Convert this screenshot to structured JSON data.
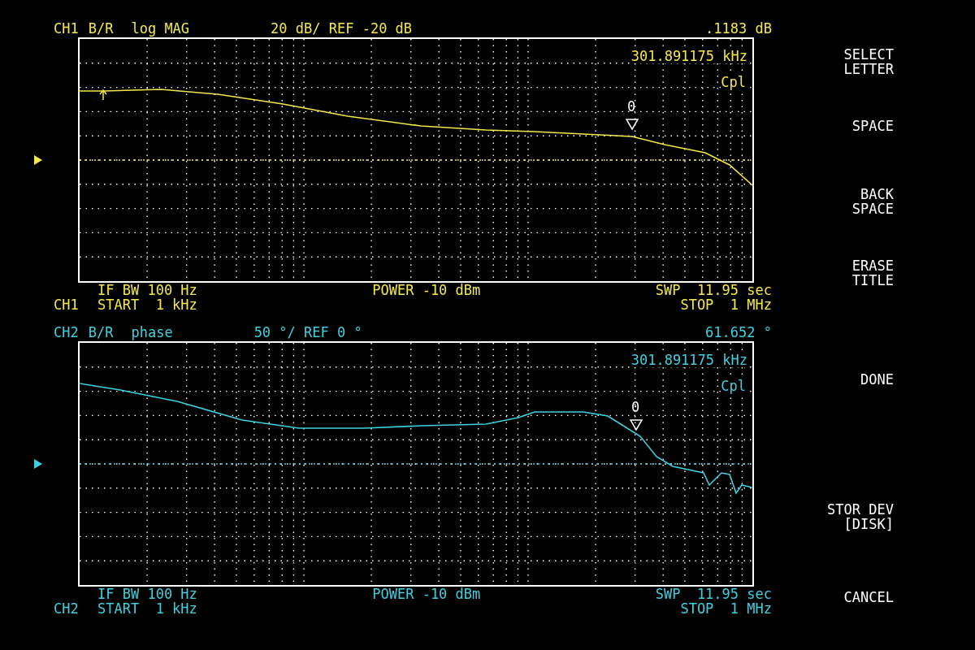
{
  "channels": [
    {
      "color": "#f2e84a",
      "label": "CH1",
      "measurement": "B/R",
      "format": "log MAG",
      "scale": "20 dB/ REF -20 dB",
      "marker_value": ".1183 dB",
      "marker_frequency": "301.891175 kHz",
      "coupling": "Cpl",
      "marker_label": "0",
      "if_bw": "IF BW 100 Hz",
      "power": "POWER -10 dBm",
      "sweep_time": "SWP  11.95 sec",
      "footer_label": "CH1",
      "start": "START  1 kHz",
      "stop": "STOP  1 MHz"
    },
    {
      "color": "#3fd0e0",
      "label": "CH2",
      "measurement": "B/R",
      "format": "phase",
      "scale": "50 °/ REF 0 °",
      "marker_value": "61.652 °",
      "marker_frequency": "301.891175 kHz",
      "coupling": "Cpl",
      "marker_label": "0",
      "if_bw": "IF BW 100 Hz",
      "power": "POWER -10 dBm",
      "sweep_time": "SWP  11.95 sec",
      "footer_label": "CH2",
      "start": "START  1 kHz",
      "stop": "STOP  1 MHz"
    }
  ],
  "softkeys": [
    "SELECT\nLETTER",
    "SPACE",
    "BACK\nSPACE",
    "ERASE\nTITLE",
    "DONE",
    "STOR DEV\n[DISK]",
    "CANCEL"
  ]
}
